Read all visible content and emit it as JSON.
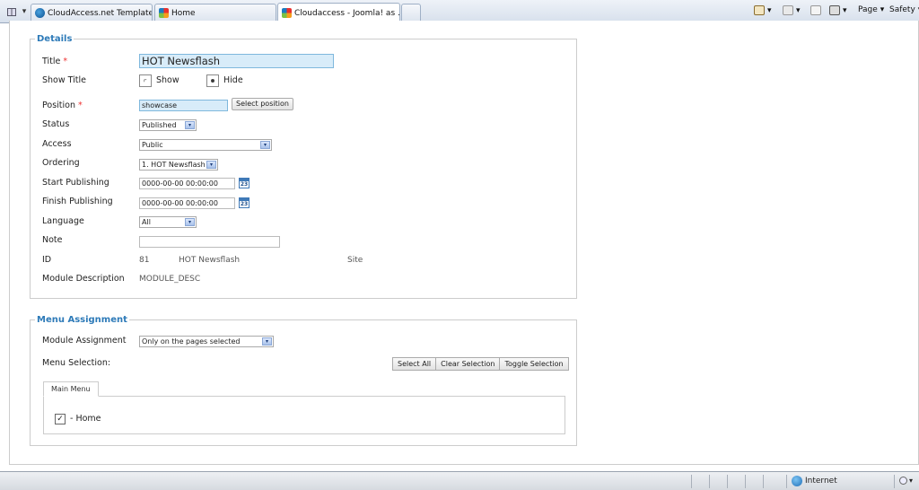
{
  "browser": {
    "tabs": [
      {
        "label": "CloudAccess.net Template D...",
        "icon": "cloudaccess-icon",
        "active": false
      },
      {
        "label": "Home",
        "icon": "joomla-icon",
        "active": false
      },
      {
        "label": "Cloudaccess - Joomla! as ...",
        "icon": "joomla-icon",
        "active": true
      }
    ],
    "tab_close_glyph": "✕",
    "toolbar": {
      "page_label": "Page",
      "safety_label": "Safety",
      "dropdown_glyph": "▾"
    }
  },
  "details": {
    "legend": "Details",
    "title_label": "Title",
    "title_value": "HOT Newsflash",
    "required_mark": "*",
    "show_title_label": "Show Title",
    "show_option": "Show",
    "hide_option": "Hide",
    "show_title_selected": "Hide",
    "position_label": "Position",
    "position_value": "showcase",
    "select_position_button": "Select position",
    "status_label": "Status",
    "status_value": "Published",
    "access_label": "Access",
    "access_value": "Public",
    "ordering_label": "Ordering",
    "ordering_value": "1. HOT Newsflash",
    "start_publishing_label": "Start Publishing",
    "start_publishing_value": "0000-00-00 00:00:00",
    "finish_publishing_label": "Finish Publishing",
    "finish_publishing_value": "0000-00-00 00:00:00",
    "calendar_day": "23",
    "language_label": "Language",
    "language_value": "All",
    "note_label": "Note",
    "note_value": "",
    "id_label": "ID",
    "id_value": "81",
    "id_title": "HOT Newsflash",
    "id_client": "Site",
    "module_description_label": "Module Description",
    "module_description_value": "MODULE_DESC"
  },
  "menu_assignment": {
    "legend": "Menu Assignment",
    "module_assignment_label": "Module Assignment",
    "module_assignment_value": "Only on the pages selected",
    "menu_selection_label": "Menu Selection:",
    "buttons": {
      "select_all": "Select All",
      "clear_selection": "Clear Selection",
      "toggle_selection": "Toggle Selection"
    },
    "tab_label": "Main Menu",
    "items": [
      {
        "label": "- Home",
        "checked": true
      }
    ],
    "check_glyph": "✓"
  },
  "statusbar": {
    "zone": "Internet"
  },
  "colors": {
    "legend": "#2d7ab8",
    "required": "#e33333",
    "highlight_input": "#d8ecf9"
  }
}
